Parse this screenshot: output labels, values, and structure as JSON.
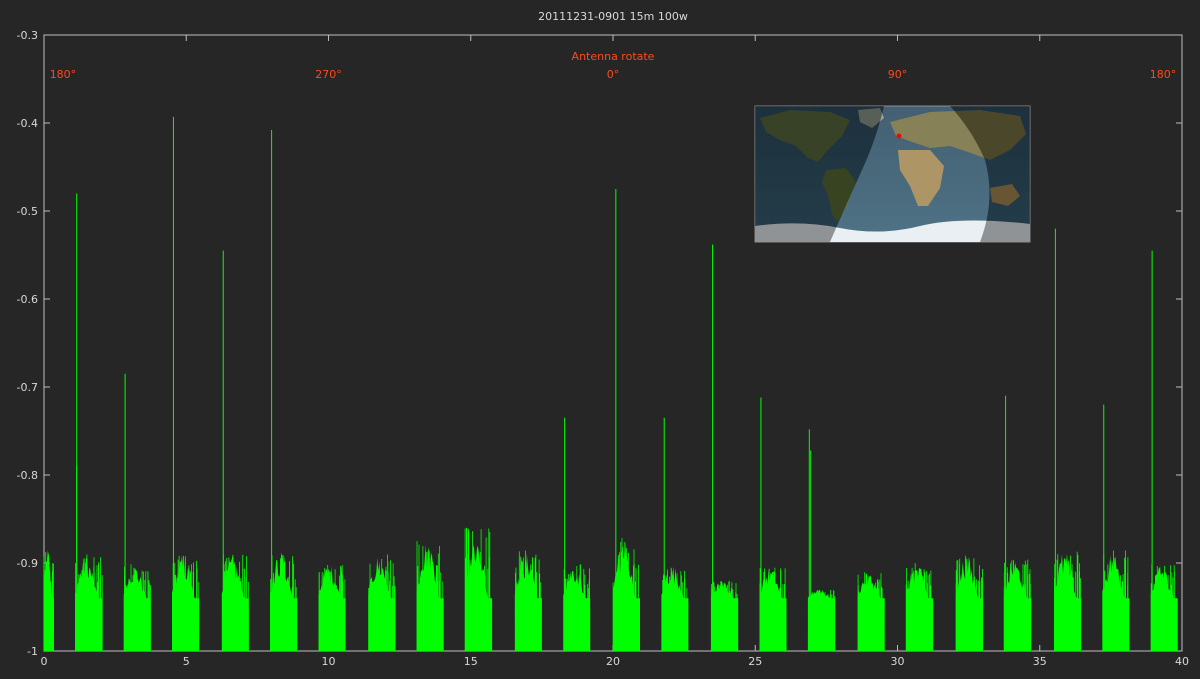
{
  "chart_data": {
    "type": "line",
    "title": "20111231-0901 15m 100w",
    "xlabel": "",
    "ylabel": "",
    "xlim": [
      0,
      40
    ],
    "ylim": [
      -1,
      -0.3
    ],
    "x_ticks": [
      0,
      5,
      10,
      15,
      20,
      25,
      30,
      35,
      40
    ],
    "y_ticks": [
      -0.3,
      -0.4,
      -0.5,
      -0.6,
      -0.7,
      -0.8,
      -0.9,
      -1
    ],
    "x_tick_labels": [
      "0",
      "5",
      "10",
      "15",
      "20",
      "25",
      "30",
      "35",
      "40"
    ],
    "y_tick_labels": [
      "-0.3",
      "-0.4",
      "-0.5",
      "-0.6",
      "-0.7",
      "-0.8",
      "-0.9",
      "-1"
    ],
    "grid": false,
    "series_color": "#00ff00",
    "annotation_color": "#ff4a1c",
    "rotation_title": "Antenna rotate",
    "rotation_marks": [
      {
        "x": 0.2,
        "label": "180°"
      },
      {
        "x": 10,
        "label": "270°"
      },
      {
        "x": 20,
        "label": "0°"
      },
      {
        "x": 30,
        "label": "90°"
      },
      {
        "x": 39.8,
        "label": "180°"
      }
    ],
    "bursts": [
      {
        "start": 0.0,
        "end": 0.35,
        "peak": -0.88
      },
      {
        "start": 1.1,
        "end": 2.05,
        "peak": -0.89
      },
      {
        "start": 2.8,
        "end": 3.75,
        "peak": -0.9
      },
      {
        "start": 4.5,
        "end": 5.45,
        "peak": -0.89
      },
      {
        "start": 6.25,
        "end": 7.2,
        "peak": -0.89
      },
      {
        "start": 7.95,
        "end": 8.9,
        "peak": -0.885
      },
      {
        "start": 9.65,
        "end": 10.6,
        "peak": -0.9
      },
      {
        "start": 11.4,
        "end": 12.35,
        "peak": -0.89
      },
      {
        "start": 13.1,
        "end": 14.05,
        "peak": -0.875
      },
      {
        "start": 14.8,
        "end": 15.75,
        "peak": -0.86
      },
      {
        "start": 16.55,
        "end": 17.5,
        "peak": -0.885
      },
      {
        "start": 18.25,
        "end": 19.2,
        "peak": -0.9
      },
      {
        "start": 20.0,
        "end": 20.95,
        "peak": -0.87
      },
      {
        "start": 21.7,
        "end": 22.65,
        "peak": -0.9
      },
      {
        "start": 23.45,
        "end": 24.4,
        "peak": -0.92
      },
      {
        "start": 25.15,
        "end": 26.1,
        "peak": -0.905
      },
      {
        "start": 26.85,
        "end": 27.8,
        "peak": -0.93
      },
      {
        "start": 28.6,
        "end": 29.55,
        "peak": -0.91
      },
      {
        "start": 30.3,
        "end": 31.25,
        "peak": -0.9
      },
      {
        "start": 32.05,
        "end": 33.0,
        "peak": -0.89
      },
      {
        "start": 33.75,
        "end": 34.7,
        "peak": -0.895
      },
      {
        "start": 35.5,
        "end": 36.45,
        "peak": -0.885
      },
      {
        "start": 37.2,
        "end": 38.15,
        "peak": -0.885
      },
      {
        "start": 38.9,
        "end": 39.85,
        "peak": -0.9
      }
    ],
    "spikes": [
      {
        "x": 1.15,
        "y": -0.48
      },
      {
        "x": 1.15,
        "y": -0.79
      },
      {
        "x": 2.85,
        "y": -0.685
      },
      {
        "x": 4.55,
        "y": -0.393
      },
      {
        "x": 6.3,
        "y": -0.545
      },
      {
        "x": 8.0,
        "y": -0.408
      },
      {
        "x": 14.85,
        "y": -0.86
      },
      {
        "x": 18.3,
        "y": -0.735
      },
      {
        "x": 20.1,
        "y": -0.475
      },
      {
        "x": 21.8,
        "y": -0.735
      },
      {
        "x": 23.5,
        "y": -0.538
      },
      {
        "x": 25.2,
        "y": -0.712
      },
      {
        "x": 26.9,
        "y": -0.748
      },
      {
        "x": 26.95,
        "y": -0.772
      },
      {
        "x": 33.8,
        "y": -0.71
      },
      {
        "x": 35.55,
        "y": -0.52
      },
      {
        "x": 37.25,
        "y": -0.72
      },
      {
        "x": 38.95,
        "y": -0.545
      }
    ]
  },
  "inset_map": {
    "marker_color": "#e01010"
  }
}
